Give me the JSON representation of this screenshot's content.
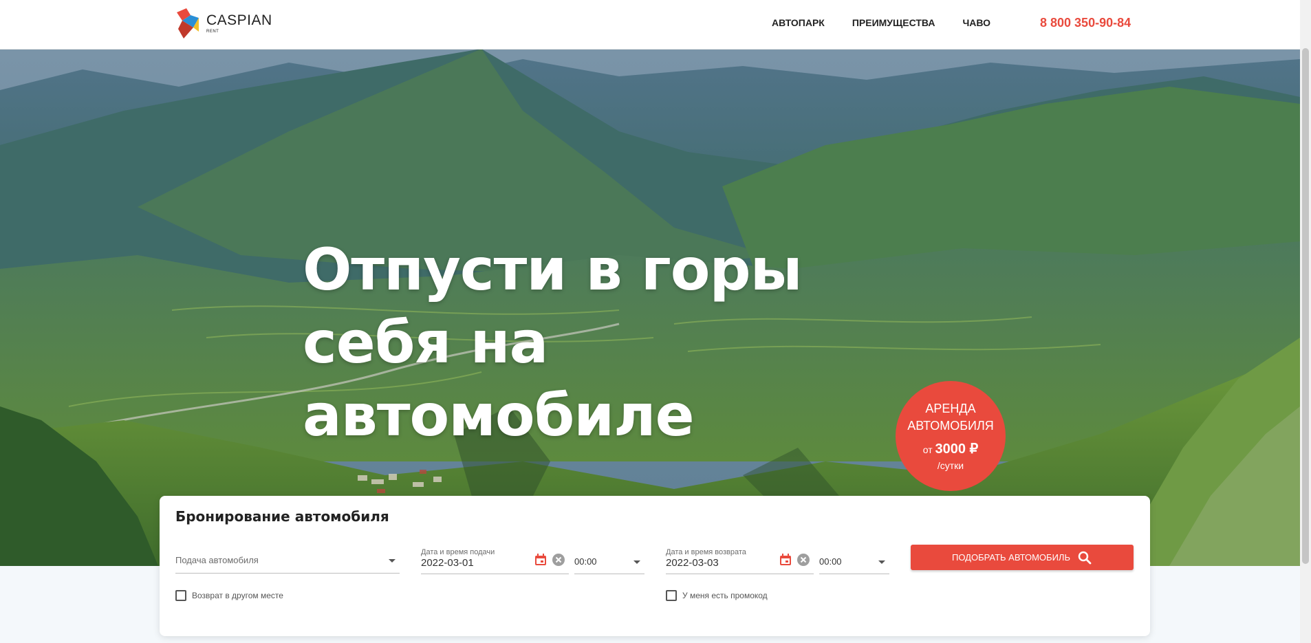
{
  "header": {
    "logo_text": "CASPIAN",
    "logo_sub": "RENT",
    "nav": [
      "АВТОПАРК",
      "ПРЕИМУЩЕСТВА",
      "ЧАВО"
    ],
    "phone": "8 800 350-90-84"
  },
  "hero": {
    "title_line1": "Отпусти в горы себя на",
    "title_line2": "автомобиле",
    "promo": {
      "line1": "АРЕНДА",
      "line2": "АВТОМОБИЛЯ",
      "prefix": "от",
      "price": "3000 ₽",
      "per": "/сутки"
    }
  },
  "booking": {
    "title": "Бронирование автомобиля",
    "pickup_placeholder": "Подача автомобиля",
    "pickup_date_label": "Дата и время подачи",
    "pickup_date": "2022-03-01",
    "pickup_time": "00:00",
    "return_date_label": "Дата и время возврата",
    "return_date": "2022-03-03",
    "return_time": "00:00",
    "search_button": "ПОДОБРАТЬ АВТОМОБИЛЬ",
    "return_other_place": "Возврат в другом месте",
    "promo_code": "У меня есть промокод"
  },
  "colors": {
    "accent": "#e94a3d",
    "text": "#222222"
  }
}
